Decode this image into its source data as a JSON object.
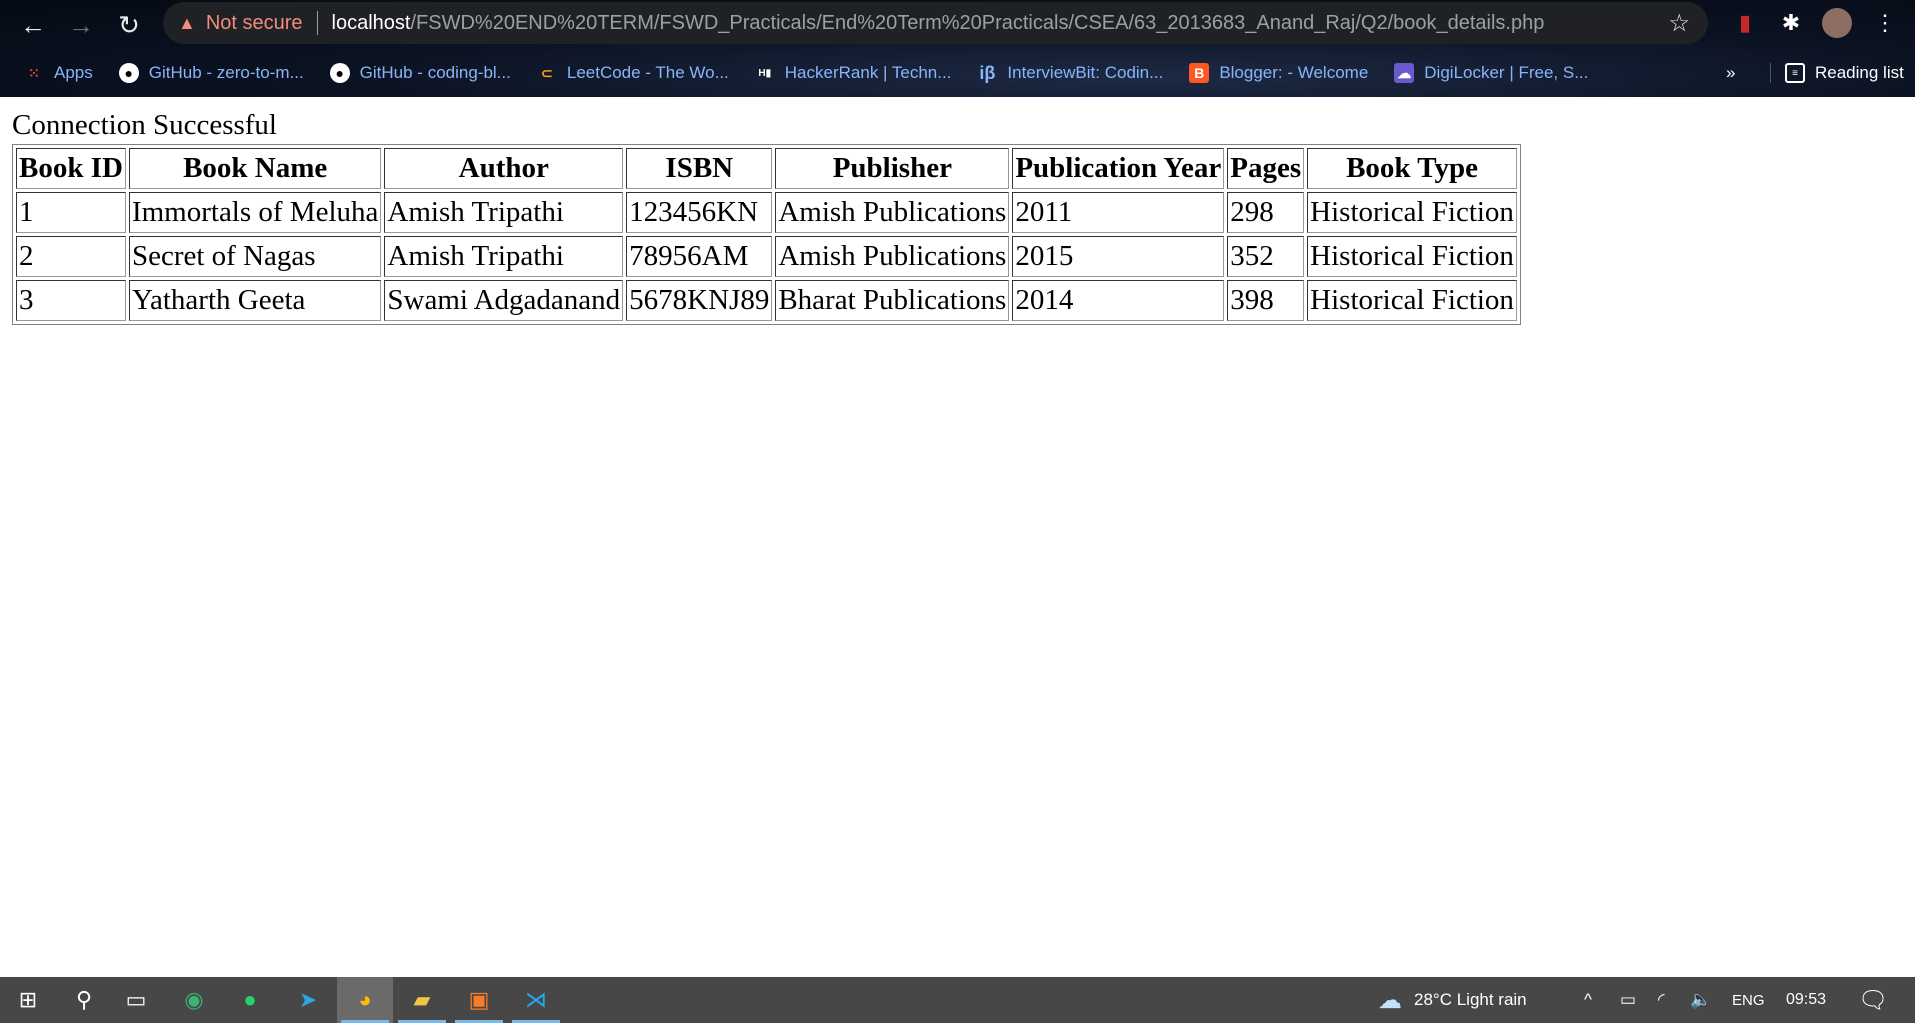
{
  "browser": {
    "security_label": "Not secure",
    "url_host": "localhost",
    "url_path": "/FSWD%20END%20TERM/FSWD_Practicals/End%20Term%20Practicals/CSEA/63_2013683_Anand_Raj/Q2/book_details.php",
    "bookmarks": [
      {
        "label": "Apps",
        "icon": "apps-grid-icon",
        "color": "#ea4335"
      },
      {
        "label": "GitHub - zero-to-m...",
        "icon": "github-icon",
        "color": "#ffffff"
      },
      {
        "label": "GitHub - coding-bl...",
        "icon": "github-icon",
        "color": "#ffffff"
      },
      {
        "label": "LeetCode - The Wo...",
        "icon": "leetcode-icon",
        "color": "#ffa116"
      },
      {
        "label": "HackerRank | Techn...",
        "icon": "hackerrank-icon",
        "color": "#1ba94c"
      },
      {
        "label": "InterviewBit: Codin...",
        "icon": "interviewbit-icon",
        "color": "#8ab4f8"
      },
      {
        "label": "Blogger: - Welcome",
        "icon": "blogger-icon",
        "color": "#ff5722"
      },
      {
        "label": "DigiLocker | Free, S...",
        "icon": "digilocker-icon",
        "color": "#6a5acd"
      }
    ],
    "more_bookmarks": "»",
    "reading_list": "Reading list"
  },
  "page": {
    "status": "Connection Successful",
    "table": {
      "headers": [
        "Book ID",
        "Book Name",
        "Author",
        "ISBN",
        "Publisher",
        "Publication Year",
        "Pages",
        "Book Type"
      ],
      "rows": [
        [
          "1",
          "Immortals of Meluha",
          "Amish Tripathi",
          "123456KN",
          "Amish Publications",
          "2011",
          "298",
          "Historical Fiction"
        ],
        [
          "2",
          "Secret of Nagas",
          "Amish Tripathi",
          "78956AM",
          "Amish Publications",
          "2015",
          "352",
          "Historical Fiction"
        ],
        [
          "3",
          "Yatharth Geeta",
          "Swami Adgadanand",
          "5678KNJ89",
          "Bharat Publications",
          "2014",
          "398",
          "Historical Fiction"
        ]
      ]
    }
  },
  "taskbar": {
    "weather": "28°C  Light rain",
    "language": "ENG",
    "time": "09:53"
  }
}
